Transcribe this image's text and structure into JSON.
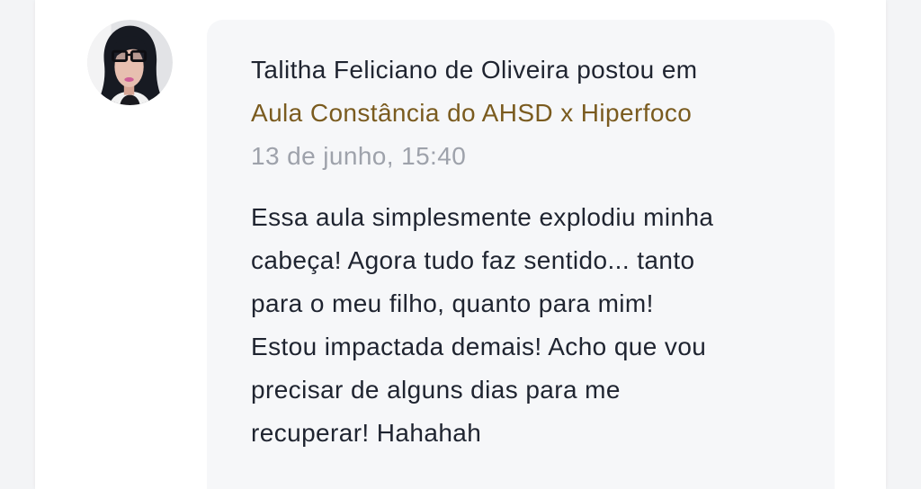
{
  "comment": {
    "author": "Talitha Feliciano de Oliveira",
    "action": "postou em",
    "lesson": "Aula Constância do AHSD x Hiperfoco",
    "timestamp": "13 de junho, 15:40",
    "body": "Essa aula simplesmente explodiu minha\ncabeça! Agora tudo faz sentido... tanto\npara o meu filho, quanto para mim!\nEstou impactada demais! Acho que vou\nprecisar de alguns dias para me\nrecuperar! Hahahah"
  },
  "colors": {
    "text": "#1f2430",
    "link": "#7a5b1f",
    "muted": "#9ea2ab",
    "bubble": "#f6f7f9",
    "page": "#f3f4f6",
    "card": "#ffffff"
  }
}
